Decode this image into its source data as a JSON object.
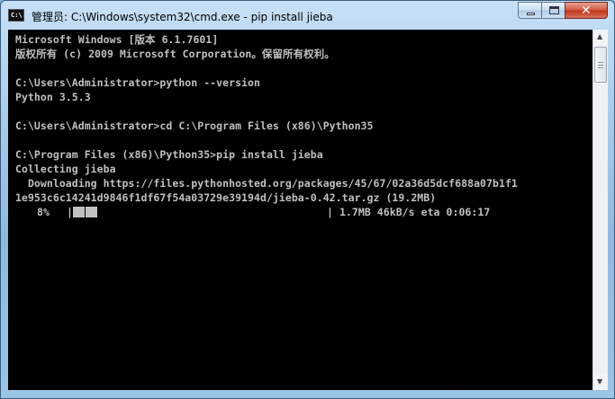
{
  "window": {
    "title": "管理员: C:\\Windows\\system32\\cmd.exe - pip  install jieba",
    "icon": "cmd-icon",
    "icon_text": "C:\\"
  },
  "console": {
    "lines": [
      "Microsoft Windows [版本 6.1.7601]",
      "版权所有 (c) 2009 Microsoft Corporation。保留所有权利。",
      "",
      "C:\\Users\\Administrator>python --version",
      "Python 3.5.3",
      "",
      "C:\\Users\\Administrator>cd C:\\Program Files (x86)\\Python35",
      "",
      "C:\\Program Files (x86)\\Python35>pip install jieba",
      "Collecting jieba",
      "  Downloading https://files.pythonhosted.org/packages/45/67/02a36d5dcf688a07b1f1",
      "1e953c6c14241d9846f1df67f54a03729e39194d/jieba-0.42.tar.gz (19.2MB)"
    ],
    "progress": {
      "percent_label": "8%",
      "bar_start": "|",
      "fraction": 0.08,
      "bar_end": "| 1.7MB 46kB/s eta 0:06:17"
    },
    "text_color": "#c0c0c0",
    "background": "#000000"
  }
}
